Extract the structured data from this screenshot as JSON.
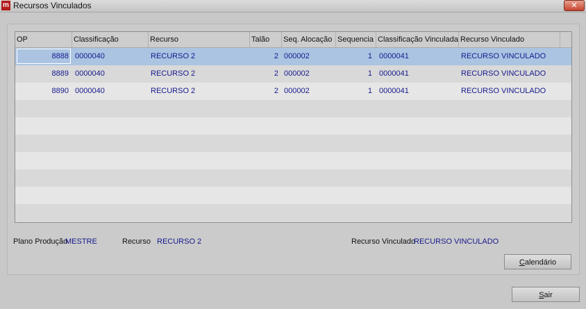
{
  "window": {
    "title": "Recursos Vinculados",
    "close_label": "✕"
  },
  "grid": {
    "columns": [
      "OP",
      "Classificação",
      "Recurso",
      "Talão",
      "Seq. Alocação",
      "Sequencia",
      "Classificação Vinculada",
      "Recurso Vinculado"
    ],
    "rows": [
      {
        "op": "8888",
        "classificacao": "0000040",
        "recurso": "RECURSO 2",
        "talao": "2",
        "seq_alocacao": "000002",
        "sequencia": "1",
        "class_vinculada": "0000041",
        "recurso_vinculado": "RECURSO VINCULADO"
      },
      {
        "op": "8889",
        "classificacao": "0000040",
        "recurso": "RECURSO 2",
        "talao": "2",
        "seq_alocacao": "000002",
        "sequencia": "1",
        "class_vinculada": "0000041",
        "recurso_vinculado": "RECURSO VINCULADO"
      },
      {
        "op": "8890",
        "classificacao": "0000040",
        "recurso": "RECURSO 2",
        "talao": "2",
        "seq_alocacao": "000002",
        "sequencia": "1",
        "class_vinculada": "0000041",
        "recurso_vinculado": "RECURSO VINCULADO"
      }
    ],
    "selected_row": 0
  },
  "footer": {
    "plano_label": "Plano Produção",
    "plano_value": "MESTRE",
    "recurso_label": "Recurso",
    "recurso_value": "RECURSO 2",
    "recurso_vinculado_label": "Recurso Vinculado",
    "recurso_vinculado_value": "RECURSO VINCULADO"
  },
  "buttons": {
    "calendario_underline": "C",
    "calendario_rest": "alendário",
    "sair_underline": "S",
    "sair_rest": "air"
  },
  "colors": {
    "data_text": "#15198c",
    "selection": "#aac4e2",
    "close_button": "#c6452e"
  }
}
